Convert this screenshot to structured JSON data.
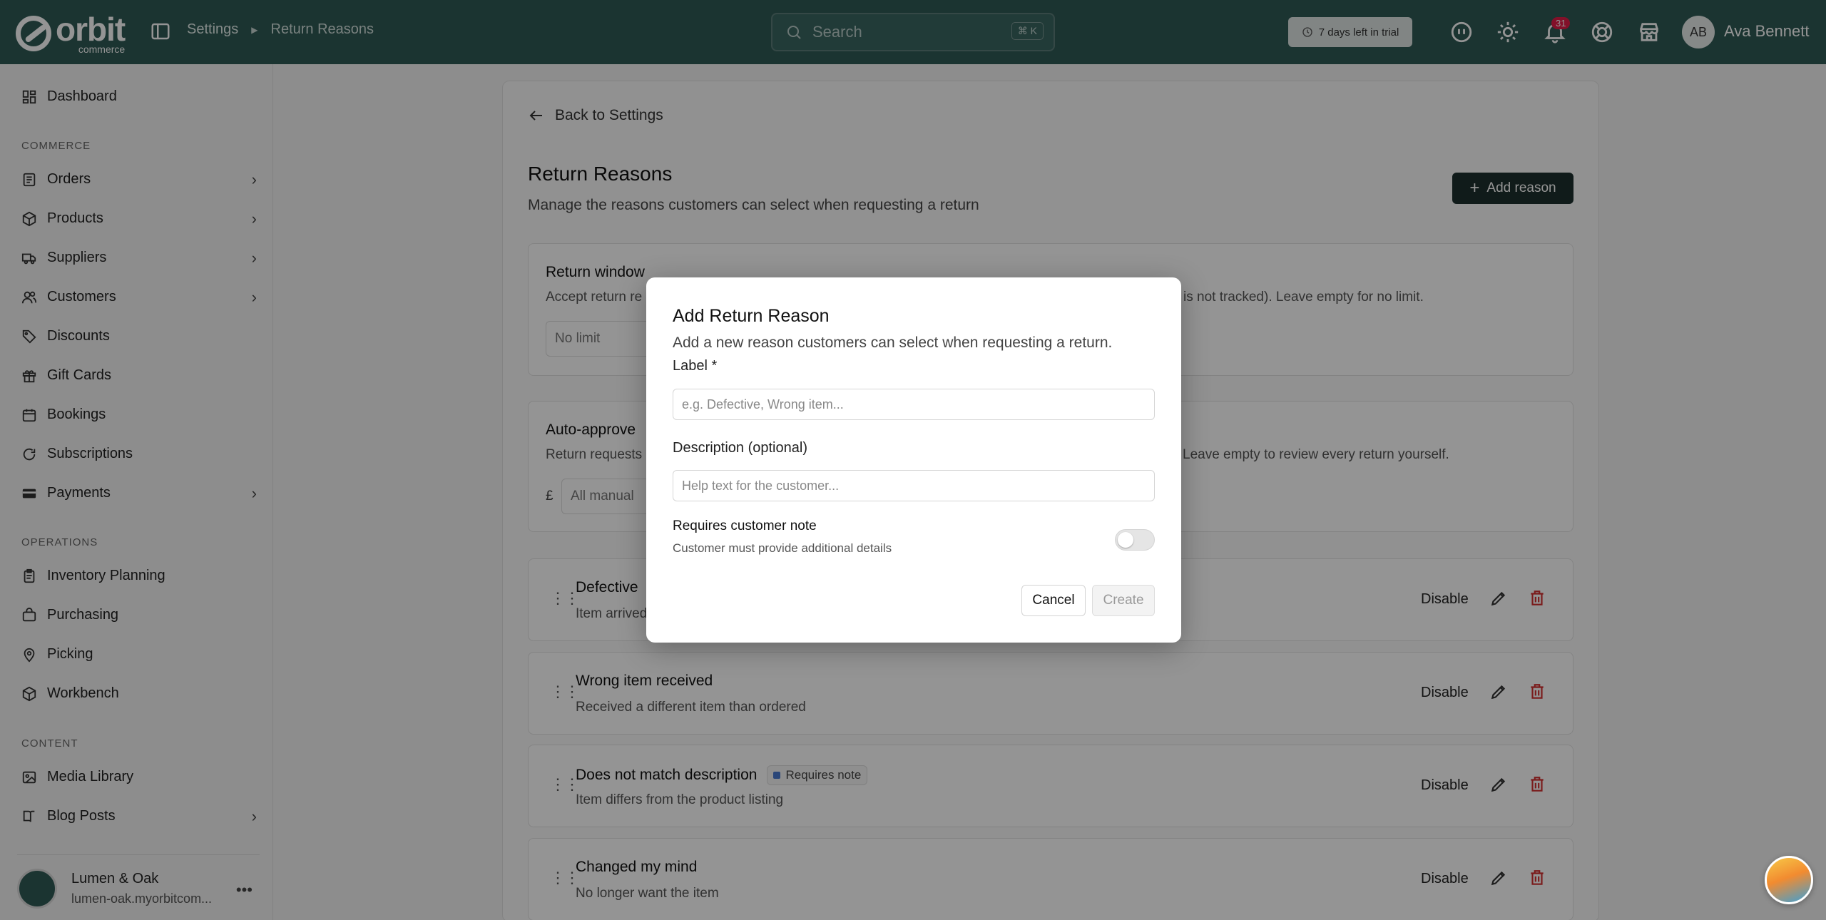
{
  "topbar": {
    "logo_word": "orbit",
    "logo_sub": "commerce",
    "breadcrumb": [
      "Settings",
      "Return Reasons"
    ],
    "search_placeholder": "Search",
    "search_shortcut": "⌘ K",
    "trial_text": "7 days left in trial",
    "notification_count": "31",
    "avatar_initials": "AB",
    "user_name": "Ava Bennett"
  },
  "sidebar": {
    "items_top": [
      {
        "label": "Dashboard",
        "icon": "dashboard-icon"
      }
    ],
    "section_commerce": "COMMERCE",
    "commerce_items": [
      {
        "label": "Orders",
        "icon": "orders-icon",
        "expandable": true
      },
      {
        "label": "Products",
        "icon": "products-icon",
        "expandable": true
      },
      {
        "label": "Suppliers",
        "icon": "suppliers-icon",
        "expandable": true
      },
      {
        "label": "Customers",
        "icon": "customers-icon",
        "expandable": true
      },
      {
        "label": "Discounts",
        "icon": "tag-icon",
        "expandable": false
      },
      {
        "label": "Gift Cards",
        "icon": "gift-icon",
        "expandable": false
      },
      {
        "label": "Bookings",
        "icon": "calendar-icon",
        "expandable": false
      },
      {
        "label": "Subscriptions",
        "icon": "subscriptions-icon",
        "expandable": false
      },
      {
        "label": "Payments",
        "icon": "card-icon",
        "expandable": true
      }
    ],
    "section_operations": "OPERATIONS",
    "operations_items": [
      {
        "label": "Inventory Planning",
        "icon": "clipboard-icon"
      },
      {
        "label": "Purchasing",
        "icon": "purchasing-icon"
      },
      {
        "label": "Picking",
        "icon": "location-icon"
      },
      {
        "label": "Workbench",
        "icon": "workbench-icon"
      }
    ],
    "section_content": "CONTENT",
    "content_items": [
      {
        "label": "Media Library",
        "icon": "image-icon",
        "expandable": false
      },
      {
        "label": "Blog Posts",
        "icon": "book-icon",
        "expandable": true
      }
    ],
    "workspace": {
      "name": "Lumen & Oak",
      "domain": "lumen-oak.myorbitcom..."
    }
  },
  "main": {
    "back_label": "Back to Settings",
    "title": "Return Reasons",
    "subtitle": "Manage the reasons customers can select when requesting a return",
    "add_button": "Add reason",
    "return_window": {
      "title": "Return window",
      "desc_start": "Accept return re",
      "desc_end": "is not tracked). Leave empty for no limit.",
      "input_placeholder": "No limit"
    },
    "auto_approve": {
      "title": "Auto-approve",
      "desc_start": "Return requests",
      "desc_end": "Leave empty to review every return yourself.",
      "currency": "£",
      "input_placeholder": "All manual"
    },
    "reasons": [
      {
        "label": "Defective",
        "desc": "Item arrived",
        "badge": "",
        "action": "Disable"
      },
      {
        "label": "Wrong item received",
        "desc": "Received a different item than ordered",
        "badge": "",
        "action": "Disable"
      },
      {
        "label": "Does not match description",
        "desc": "Item differs from the product listing",
        "badge": "Requires note",
        "action": "Disable"
      },
      {
        "label": "Changed my mind",
        "desc": "No longer want the item",
        "badge": "",
        "action": "Disable"
      }
    ]
  },
  "modal": {
    "title": "Add Return Reason",
    "subtitle": "Add a new reason customers can select when requesting a return.",
    "label_field": {
      "label": "Label *",
      "placeholder": "e.g. Defective, Wrong item...",
      "value": ""
    },
    "description_field": {
      "label": "Description (optional)",
      "placeholder": "Help text for the customer...",
      "value": ""
    },
    "toggle": {
      "label": "Requires customer note",
      "help": "Customer must provide additional details",
      "on": false
    },
    "cancel_label": "Cancel",
    "create_label": "Create"
  },
  "colors": {
    "topbar": "#2f5a55",
    "primary_button": "#1d2f2d",
    "delete": "#d32f2f",
    "badge_dot": "#4a7bd0",
    "notification": "#e11d48"
  }
}
